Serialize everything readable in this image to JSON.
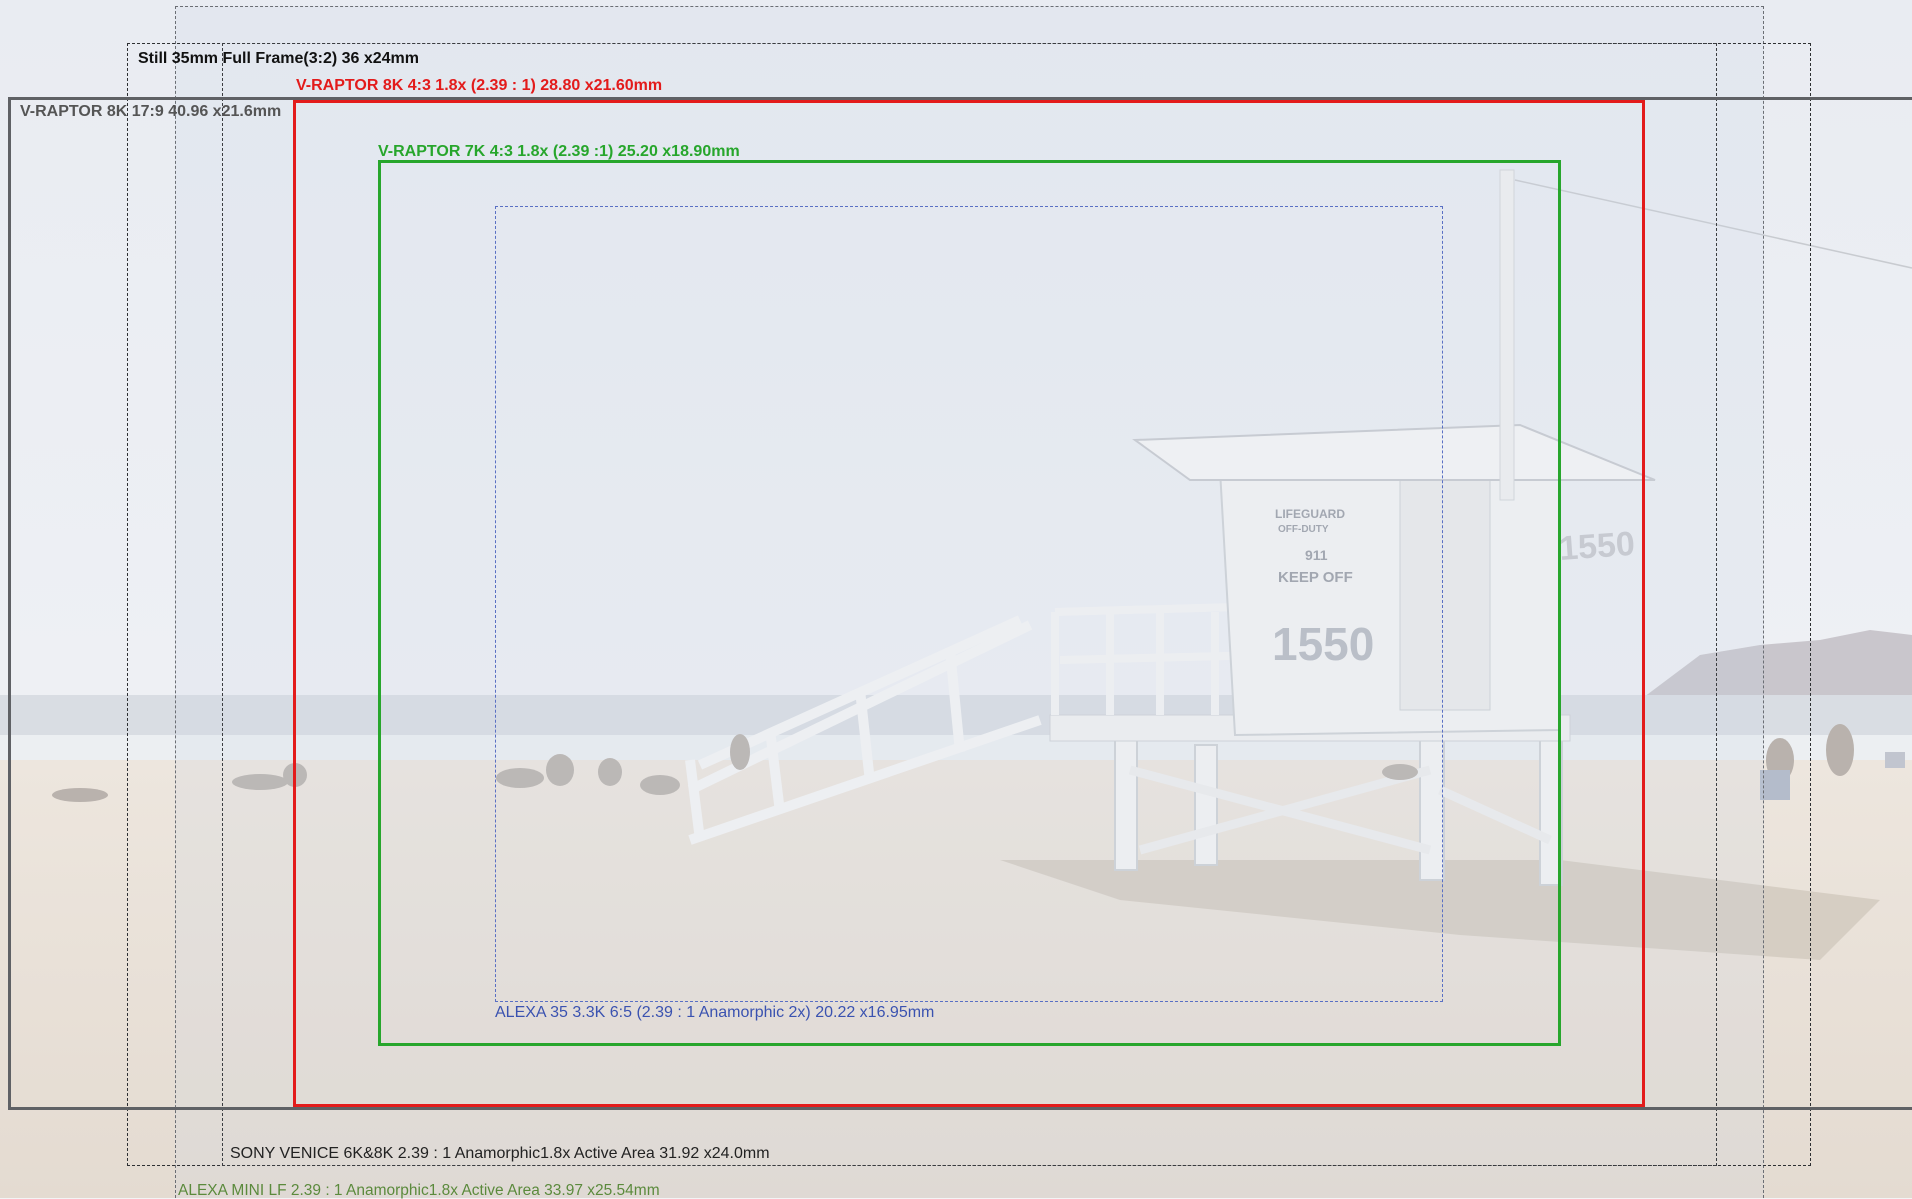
{
  "frames": {
    "alexa_mini_lf": {
      "label": "ALEXA MINI LF  2.39 : 1 Anamorphic1.8x Active Area  33.97 x25.54mm",
      "color": "#5b8a3c"
    },
    "still_35mm": {
      "label": "Still 35mm Full Frame(3:2) 36 x24mm",
      "color": "#111111"
    },
    "sony_venice": {
      "label": "SONY VENICE 6K&8K  2.39 : 1 Anamorphic1.8x Active Area  31.92 x24.0mm",
      "color": "#222222"
    },
    "vraptor_8k_17_9": {
      "label": "V-RAPTOR  8K 17:9  40.96 x21.6mm",
      "color": "#555555"
    },
    "vraptor_8k_4_3": {
      "label": "V-RAPTOR 8K 4:3 1.8x (2.39 : 1)  28.80 x21.60mm",
      "color": "#e31b1b"
    },
    "vraptor_7k_4_3": {
      "label": "V-RAPTOR 7K 4:3 1.8x (2.39 :1)  25.20 x18.90mm",
      "color": "#27a62c"
    },
    "alexa_35": {
      "label": "ALEXA 35  3.3K 6:5 (2.39 : 1 Anamorphic 2x) 20.22 x16.95mm",
      "color": "#3a52b0"
    }
  },
  "photo": {
    "tower_number": "1550",
    "tower_number_side": "1550",
    "sign_lines": [
      "LIFEGUARD",
      "OFF-DUTY",
      "911",
      "KEEP OFF"
    ]
  }
}
